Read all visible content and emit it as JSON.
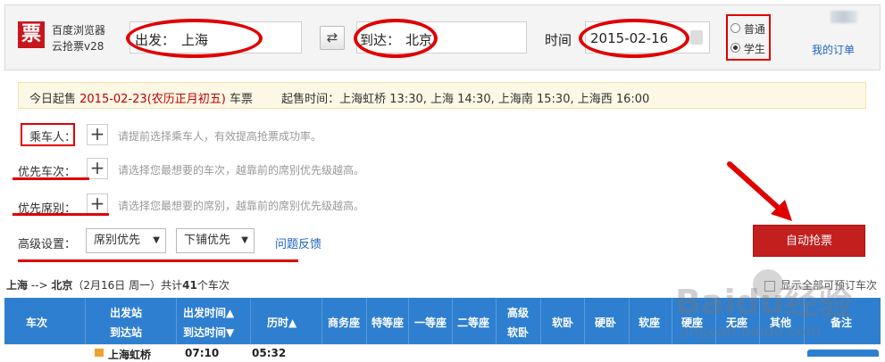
{
  "header": {
    "logo_char": "票",
    "brand_line1": "百度浏览器",
    "brand_line2": "云抢票v28",
    "from_label": "出发：",
    "from_value": "上海",
    "swap_icon": "swap-arrows-icon",
    "to_label": "到达：",
    "to_value": "北京",
    "time_label": "时间",
    "date_value": "2015-02-16",
    "ticket_types": [
      {
        "label": "普通",
        "checked": false
      },
      {
        "label": "学生",
        "checked": true
      }
    ],
    "my_orders": "我的订单"
  },
  "notice": {
    "prefix": "今日起售 ",
    "date": "2015-02-23(农历正月初五)",
    "suffix": " 车票",
    "time_label": "起售时间：",
    "times": "上海虹桥 13:30, 上海 14:30, 上海南 15:30, 上海西 16:00"
  },
  "form": {
    "passenger_label": "乘车人：",
    "passenger_hint": "请提前选择乘车人，有效提高抢票成功率。",
    "train_label": "优先车次：",
    "train_hint": "请选择您最想要的车次，越靠前的席别优先级越高。",
    "seat_label": "优先席别：",
    "seat_hint": "请选择您最想要的席别，越靠前的席别优先级越高。",
    "advanced_label": "高级设置：",
    "select1": "席别优先",
    "select2": "下铺优先",
    "feedback": "问题反馈",
    "grab_button": "自动抢票"
  },
  "route": {
    "from": "上海",
    "arrow": " --> ",
    "to": "北京",
    "date": "（2月16日  周一）",
    "count_prefix": "共计",
    "count": "41",
    "count_suffix": "个车次",
    "show_all": "显示全部可预订车次"
  },
  "table": {
    "headers": [
      "车次",
      "出发站",
      "到达站",
      "出发时间▲",
      "到达时间▼",
      "历时▲",
      "商务座",
      "特等座",
      "一等座",
      "二等座",
      "高级",
      "软卧",
      "软卧",
      "硬卧",
      "软座",
      "硬座",
      "无座",
      "其他",
      "备注"
    ],
    "first_row": {
      "station": "上海虹桥",
      "depart": "07:10",
      "duration": "05:32"
    }
  },
  "watermark": {
    "main": "Baidu经验",
    "sub": "jingyan.baidu.com"
  }
}
